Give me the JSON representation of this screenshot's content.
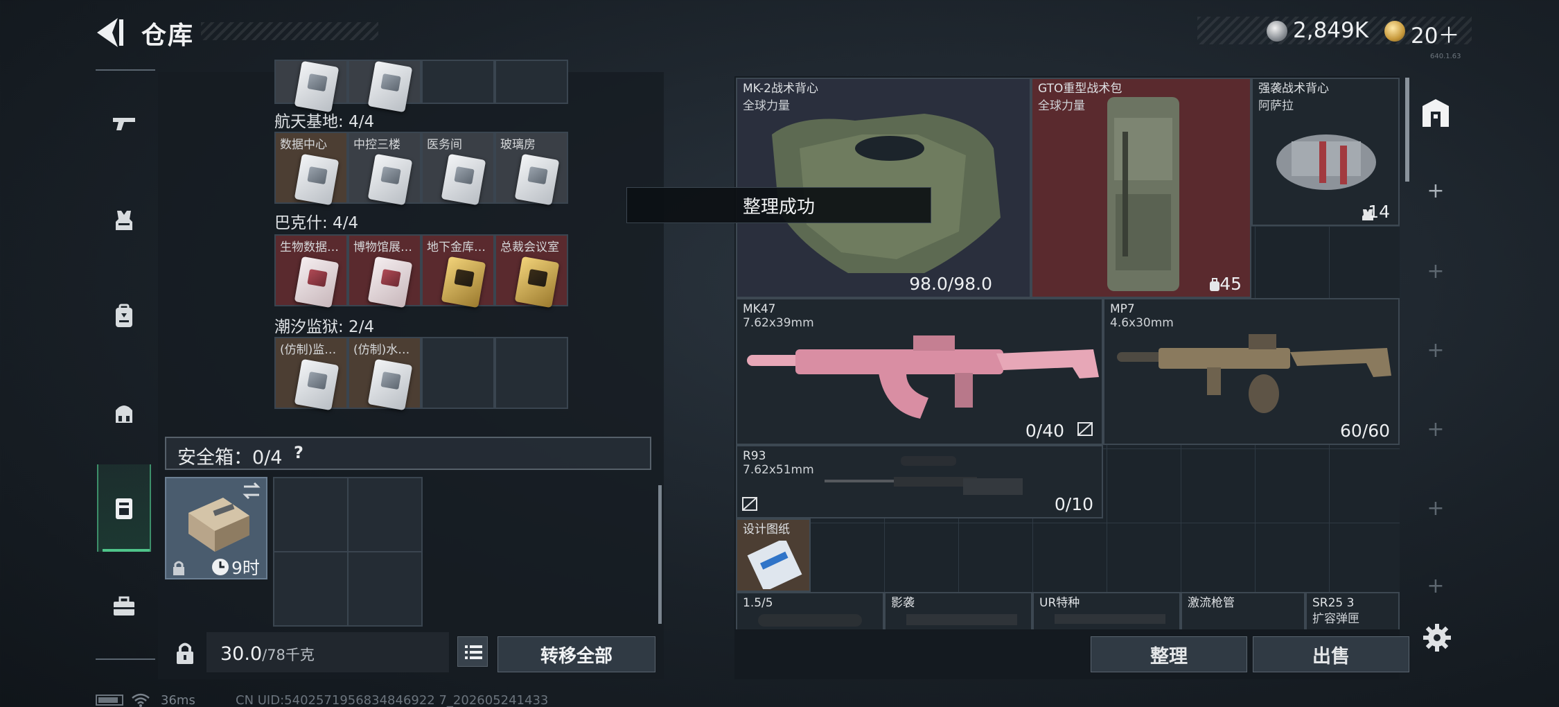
{
  "header": {
    "title": "仓库",
    "silver_amount": "2,849K",
    "gold_amount": "20＋",
    "version": "640.1.63"
  },
  "nav": {
    "items": [
      "weapons",
      "armor",
      "backpack",
      "chest-rig",
      "safebox",
      "toolbox"
    ],
    "active": "safebox"
  },
  "keycards": {
    "partial_top": {
      "cells": [
        "grey",
        "grey",
        "empty",
        "empty"
      ]
    },
    "groups": [
      {
        "title": "航天基地: 4/4",
        "cells": [
          {
            "label": "数据中心",
            "style": "brown"
          },
          {
            "label": "中控三楼",
            "style": "grey"
          },
          {
            "label": "医务间",
            "style": "grey"
          },
          {
            "label": "玻璃房",
            "style": "grey"
          }
        ]
      },
      {
        "title": "巴克什: 4/4",
        "cells": [
          {
            "label": "生物数据…",
            "style": "red"
          },
          {
            "label": "博物馆展…",
            "style": "red"
          },
          {
            "label": "地下金库…",
            "style": "red"
          },
          {
            "label": "总裁会议室",
            "style": "red"
          }
        ]
      },
      {
        "title": "潮汐监狱: 2/4",
        "cells": [
          {
            "label": "(仿制)监…",
            "style": "brown"
          },
          {
            "label": "(仿制)水…",
            "style": "brown"
          },
          {
            "label": "",
            "style": "empty"
          },
          {
            "label": "",
            "style": "empty"
          }
        ]
      }
    ]
  },
  "safebox": {
    "label": "安全箱：0/4",
    "help": "?",
    "timer": "9时"
  },
  "footer_left": {
    "weight_current": "30.0",
    "weight_max": "/78千克",
    "transfer_all": "转移全部"
  },
  "toast": {
    "message": "整理成功"
  },
  "inventory": {
    "vest": {
      "name": "MK-2战术背心",
      "brand": "全球力量",
      "durability": "98.0/98.0"
    },
    "pack": {
      "name": "GTO重型战术包",
      "brand": "全球力量",
      "count": "45"
    },
    "pack2": {
      "name": "强袭战术背心",
      "brand": "阿萨拉",
      "count": "14"
    },
    "mk47": {
      "name": "MK47",
      "caliber": "7.62x39mm",
      "ammo": "0/40"
    },
    "mp7": {
      "name": "MP7",
      "caliber": "4.6x30mm",
      "ammo": "60/60"
    },
    "r93": {
      "name": "R93",
      "caliber": "7.62x51mm",
      "ammo": "0/10"
    },
    "blueprint": {
      "name": "设计图纸"
    },
    "row_bottom": [
      {
        "name": "1.5/5",
        "sub": ""
      },
      {
        "name": "影袭",
        "sub": ""
      },
      {
        "name": "UR特种",
        "sub": ""
      },
      {
        "name": "激流枪管",
        "sub": ""
      },
      {
        "name": "SR25 3",
        "sub": "扩容弹匣"
      }
    ]
  },
  "footer_right": {
    "sort_label": "整理",
    "sell_label": "出售"
  },
  "status": {
    "ping": "36ms",
    "uid": "CN UID:5402571956834846922 7_202605241433"
  },
  "colors": {
    "accent_green": "#4fc48a",
    "cell_red": "#5a2a2e",
    "cell_brown": "#4c3e33"
  }
}
